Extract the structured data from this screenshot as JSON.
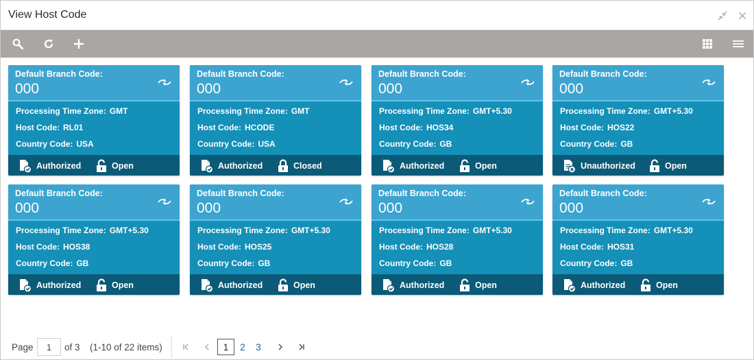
{
  "window": {
    "title": "View Host Code"
  },
  "toolbar": {
    "icons": [
      "search-icon",
      "refresh-icon",
      "add-icon",
      "grid-view-icon",
      "list-view-icon"
    ]
  },
  "labels": {
    "default_branch_code": "Default Branch Code:",
    "processing_time_zone": "Processing Time Zone:",
    "host_code": "Host Code:",
    "country_code": "Country Code:"
  },
  "cards": [
    {
      "branch": "000",
      "tz": "GMT",
      "host": "RL01",
      "country": "USA",
      "auth": "Authorized",
      "lock": "Open"
    },
    {
      "branch": "000",
      "tz": "GMT",
      "host": "HCODE",
      "country": "USA",
      "auth": "Authorized",
      "lock": "Closed"
    },
    {
      "branch": "000",
      "tz": "GMT+5.30",
      "host": "HOS34",
      "country": "GB",
      "auth": "Authorized",
      "lock": "Open"
    },
    {
      "branch": "000",
      "tz": "GMT+5.30",
      "host": "HOS22",
      "country": "GB",
      "auth": "Unauthorized",
      "lock": "Open"
    },
    {
      "branch": "000",
      "tz": "GMT+5.30",
      "host": "HOS38",
      "country": "GB",
      "auth": "Authorized",
      "lock": "Open"
    },
    {
      "branch": "000",
      "tz": "GMT+5.30",
      "host": "HOS25",
      "country": "GB",
      "auth": "Authorized",
      "lock": "Open"
    },
    {
      "branch": "000",
      "tz": "GMT+5.30",
      "host": "HOS28",
      "country": "GB",
      "auth": "Authorized",
      "lock": "Open"
    },
    {
      "branch": "000",
      "tz": "GMT+5.30",
      "host": "HOS31",
      "country": "GB",
      "auth": "Authorized",
      "lock": "Open"
    }
  ],
  "pagination": {
    "page_label": "Page",
    "current_page": "1",
    "of_label": "of 3",
    "items_summary": "(1-10 of 22 items)",
    "pages": [
      "1",
      "2",
      "3"
    ]
  },
  "colors": {
    "toolbar_bg": "#aaa6a3",
    "card_header": "#3ca4cf",
    "card_body": "#1590b8",
    "card_footer": "#0b5a77",
    "link": "#1a5fa0"
  }
}
